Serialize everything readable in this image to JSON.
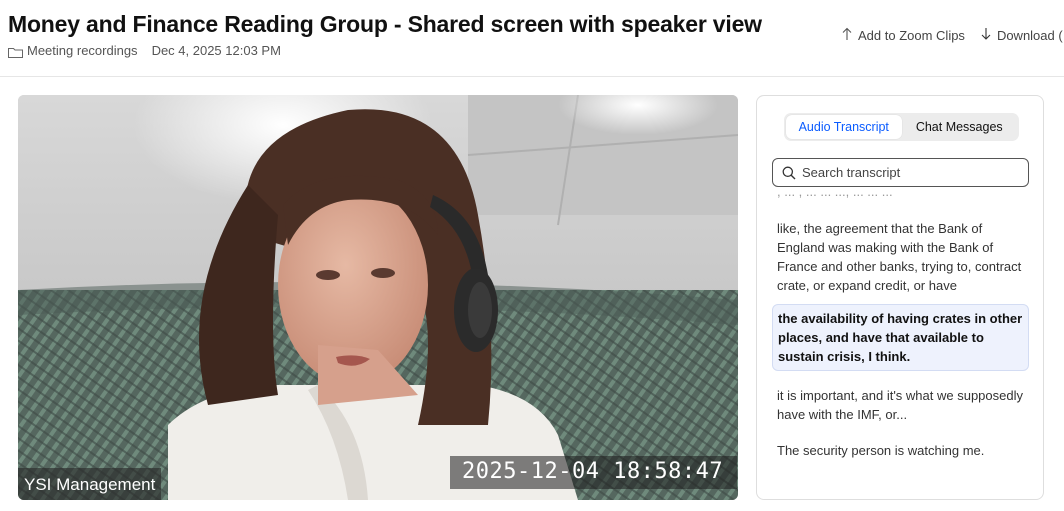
{
  "header": {
    "title": "Money and Finance Reading Group - Shared screen with speaker view",
    "folder_label": "Meeting recordings",
    "date": "Dec 4, 2025 12:03 PM",
    "actions": {
      "add_to_clips": "Add to Zoom Clips",
      "download": "Download ("
    }
  },
  "video": {
    "participant_name": "YSI Management",
    "timestamp_overlay": "2025-12-04  18:58:47"
  },
  "panel": {
    "tabs": [
      {
        "label": "Audio Transcript",
        "active": true
      },
      {
        "label": "Chat Messages",
        "active": false
      }
    ],
    "search_placeholder": "Search transcript",
    "transcript": {
      "partial_line": ", ... , ... ... ..., ... ... ...",
      "segments": [
        {
          "text": "like, the agreement that the Bank of England was making with the Bank of France and other banks, trying to, contract crate, or expand credit, or have",
          "active": false
        },
        {
          "text": "the availability of having crates in other places, and have that available to sustain crisis, I think.",
          "active": true
        },
        {
          "text": "it is important, and it's what we supposedly have with the IMF, or...",
          "active": false
        },
        {
          "text": "The security person is watching me.",
          "active": false
        }
      ]
    }
  },
  "colors": {
    "accent": "#0b5cff",
    "active_segment_bg": "#eef2fd"
  },
  "icons": {
    "folder": "folder-icon",
    "upload": "upload-icon",
    "download": "download-icon",
    "search": "search-icon"
  }
}
